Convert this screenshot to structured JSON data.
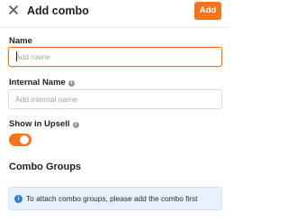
{
  "header": {
    "close_icon": "close-icon",
    "title": "Add combo",
    "add_label": "Add",
    "accent_color": "#f47320"
  },
  "form": {
    "name": {
      "label": "Name",
      "value": "",
      "placeholder": "Add name",
      "focused": true
    },
    "internal_name": {
      "label": "Internal Name",
      "info_icon": "info-icon",
      "value": "",
      "placeholder": "Add internal name"
    },
    "show_in_upsell": {
      "label": "Show in Upsell",
      "info_icon": "info-icon",
      "enabled": true
    }
  },
  "combo_groups": {
    "title": "Combo Groups",
    "notice_icon": "info-icon",
    "notice": "To attach combo groups, please add the combo first",
    "notice_color": "#e6f1fc"
  }
}
